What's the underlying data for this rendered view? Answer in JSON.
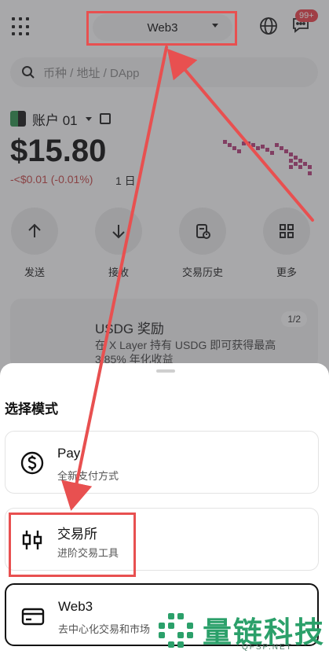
{
  "header": {
    "mode_label": "Web3",
    "notification_badge": "99+"
  },
  "search": {
    "placeholder": "币种 / 地址 / DApp"
  },
  "account": {
    "name": "账户 01",
    "balance": "$15.80",
    "change": "-<$0.01 (-0.01%)",
    "period": "1 日"
  },
  "actions": [
    {
      "label": "发送",
      "icon": "arrow-up-icon"
    },
    {
      "label": "接收",
      "icon": "arrow-down-icon"
    },
    {
      "label": "交易历史",
      "icon": "history-icon"
    },
    {
      "label": "更多",
      "icon": "grid-icon"
    }
  ],
  "promo": {
    "title": "USDG 奖励",
    "text": "在 X Layer 持有 USDG 即可获得最高 3.85% 年化收益",
    "counter": "1/2"
  },
  "sheet": {
    "title": "选择模式",
    "options": [
      {
        "title": "Pay",
        "subtitle": "全新支付方式",
        "icon": "dollar-coin-icon"
      },
      {
        "title": "交易所",
        "subtitle": "进阶交易工具",
        "icon": "candlestick-icon"
      },
      {
        "title": "Web3",
        "subtitle": "去中心化交易和市场",
        "icon": "wallet-card-icon"
      }
    ]
  },
  "watermark": {
    "text": "量链科技",
    "url": "QFSP.NET"
  },
  "colors": {
    "annotation_red": "#e85050",
    "watermark_green": "#2ba06a",
    "negative_red": "#c24848"
  }
}
